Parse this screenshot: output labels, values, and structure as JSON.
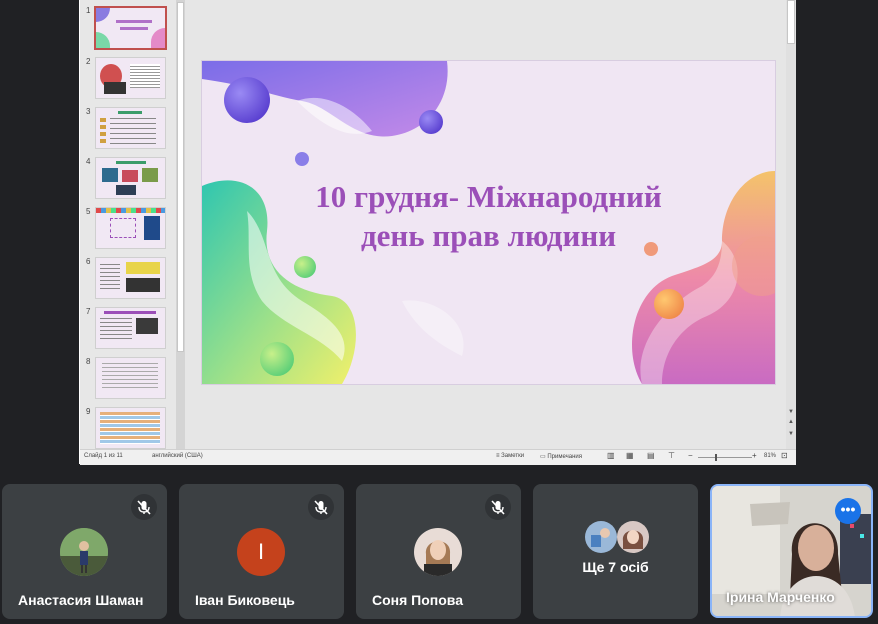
{
  "presentation": {
    "slide_title_line1": "10 грудня- Міжнародний",
    "slide_title_line2": "день прав людини",
    "thumbnails": [
      {
        "num": "1",
        "active": true
      },
      {
        "num": "2"
      },
      {
        "num": "3"
      },
      {
        "num": "4"
      },
      {
        "num": "5"
      },
      {
        "num": "6"
      },
      {
        "num": "7"
      },
      {
        "num": "8"
      },
      {
        "num": "9"
      }
    ],
    "status": {
      "slide_counter": "Слайд 1 из 11",
      "language": "английский (США)",
      "notes": "Заметки",
      "comments": "Примечания",
      "zoom": "81%"
    },
    "colors": {
      "title": "#9b4fb8",
      "slide_bg": "#f0e6f3"
    }
  },
  "participants": [
    {
      "name": "Анастасия Шаман",
      "muted": true
    },
    {
      "name": "Іван Биковець",
      "muted": true,
      "initial": "I",
      "avatar_color": "#c5421c"
    },
    {
      "name": "Соня Попова",
      "muted": true
    },
    {
      "name": "Ще 7 осіб"
    },
    {
      "name": "Ірина Марченко",
      "self_view": true
    }
  ],
  "colors": {
    "background": "#202124",
    "tile": "#3c4043",
    "accent": "#1a73e8",
    "active_border": "#8ab4f8"
  }
}
